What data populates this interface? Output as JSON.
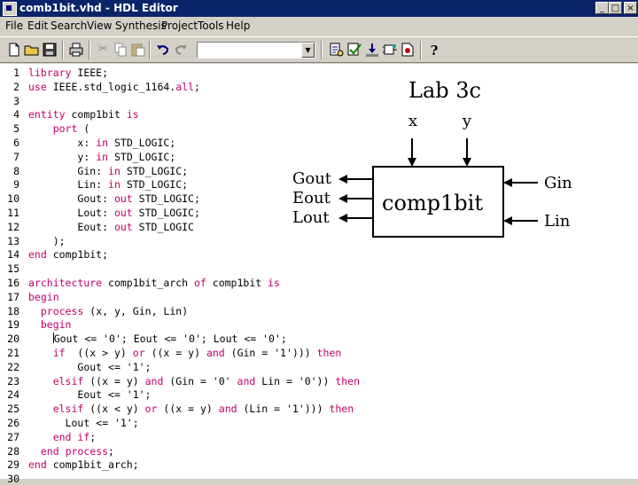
{
  "window": {
    "title": "comb1bit.vhd - HDL Editor",
    "min_label": "_",
    "max_label": "□",
    "close_label": "×"
  },
  "menu": [
    "File",
    "Edit",
    "Search",
    "View",
    "Synthesis",
    "Project",
    "Tools",
    "Help"
  ],
  "toolbar": {
    "combo_value": "",
    "icons": [
      "new-file-icon",
      "open-folder-icon",
      "save-icon",
      "print-icon",
      "cut-icon",
      "copy-icon",
      "paste-icon",
      "undo-icon",
      "redo-icon",
      "syntax-check-icon",
      "check-icon",
      "download-icon",
      "design-wizard-icon",
      "language-assistant-icon",
      "find-icon",
      "help-icon"
    ]
  },
  "editor": {
    "lines": [
      {
        "n": "1",
        "text": "library IEEE;"
      },
      {
        "n": "2",
        "text": "use IEEE.std_logic_1164.all;"
      },
      {
        "n": "3",
        "text": ""
      },
      {
        "n": "4",
        "text": "entity comp1bit is"
      },
      {
        "n": "5",
        "text": "    port ("
      },
      {
        "n": "6",
        "text": "        x: in STD_LOGIC;"
      },
      {
        "n": "7",
        "text": "        y: in STD_LOGIC;"
      },
      {
        "n": "8",
        "text": "        Gin: in STD_LOGIC;"
      },
      {
        "n": "9",
        "text": "        Lin: in STD_LOGIC;"
      },
      {
        "n": "10",
        "text": "        Gout: out STD_LOGIC;"
      },
      {
        "n": "11",
        "text": "        Lout: out STD_LOGIC;"
      },
      {
        "n": "12",
        "text": "        Eout: out STD_LOGIC"
      },
      {
        "n": "13",
        "text": "    );"
      },
      {
        "n": "14",
        "text": "end comp1bit;"
      },
      {
        "n": "15",
        "text": ""
      },
      {
        "n": "16",
        "text": "architecture comp1bit_arch of comp1bit is"
      },
      {
        "n": "17",
        "text": "begin"
      },
      {
        "n": "18",
        "text": "  process (x, y, Gin, Lin)"
      },
      {
        "n": "19",
        "text": "  begin"
      },
      {
        "n": "20",
        "text": "    Gout <= '0'; Eout <= '0'; Lout <= '0';"
      },
      {
        "n": "21",
        "text": "    if  ((x > y) or ((x = y) and (Gin = '1'))) then"
      },
      {
        "n": "22",
        "text": "        Gout <= '1';"
      },
      {
        "n": "23",
        "text": "    elsif ((x = y) and (Gin = '0' and Lin = '0')) then"
      },
      {
        "n": "24",
        "text": "        Eout <= '1';"
      },
      {
        "n": "25",
        "text": "    elsif ((x < y) or ((x = y) and (Lin = '1'))) then"
      },
      {
        "n": "26",
        "text": "      Lout <= '1';"
      },
      {
        "n": "27",
        "text": "    end if;"
      },
      {
        "n": "28",
        "text": "  end process;"
      },
      {
        "n": "29",
        "text": "end comp1bit_arch;"
      },
      {
        "n": "30",
        "text": ""
      }
    ],
    "keywords": [
      "library",
      "use",
      "all",
      "entity",
      "is",
      "port",
      "in",
      "out",
      "end",
      "architecture",
      "of",
      "begin",
      "process",
      "if",
      "or",
      "and",
      "then",
      "elsif"
    ]
  },
  "diagram": {
    "title": "Lab 3c",
    "block_label": "comp1bit",
    "top_inputs": [
      "x",
      "y"
    ],
    "left_outputs": [
      "Gout",
      "Eout",
      "Lout"
    ],
    "right_inputs": [
      "Gin",
      "Lin"
    ]
  },
  "colors": {
    "keyword": "#c0006a",
    "titlebar": "#0a246a",
    "chrome": "#d4d0c8"
  }
}
